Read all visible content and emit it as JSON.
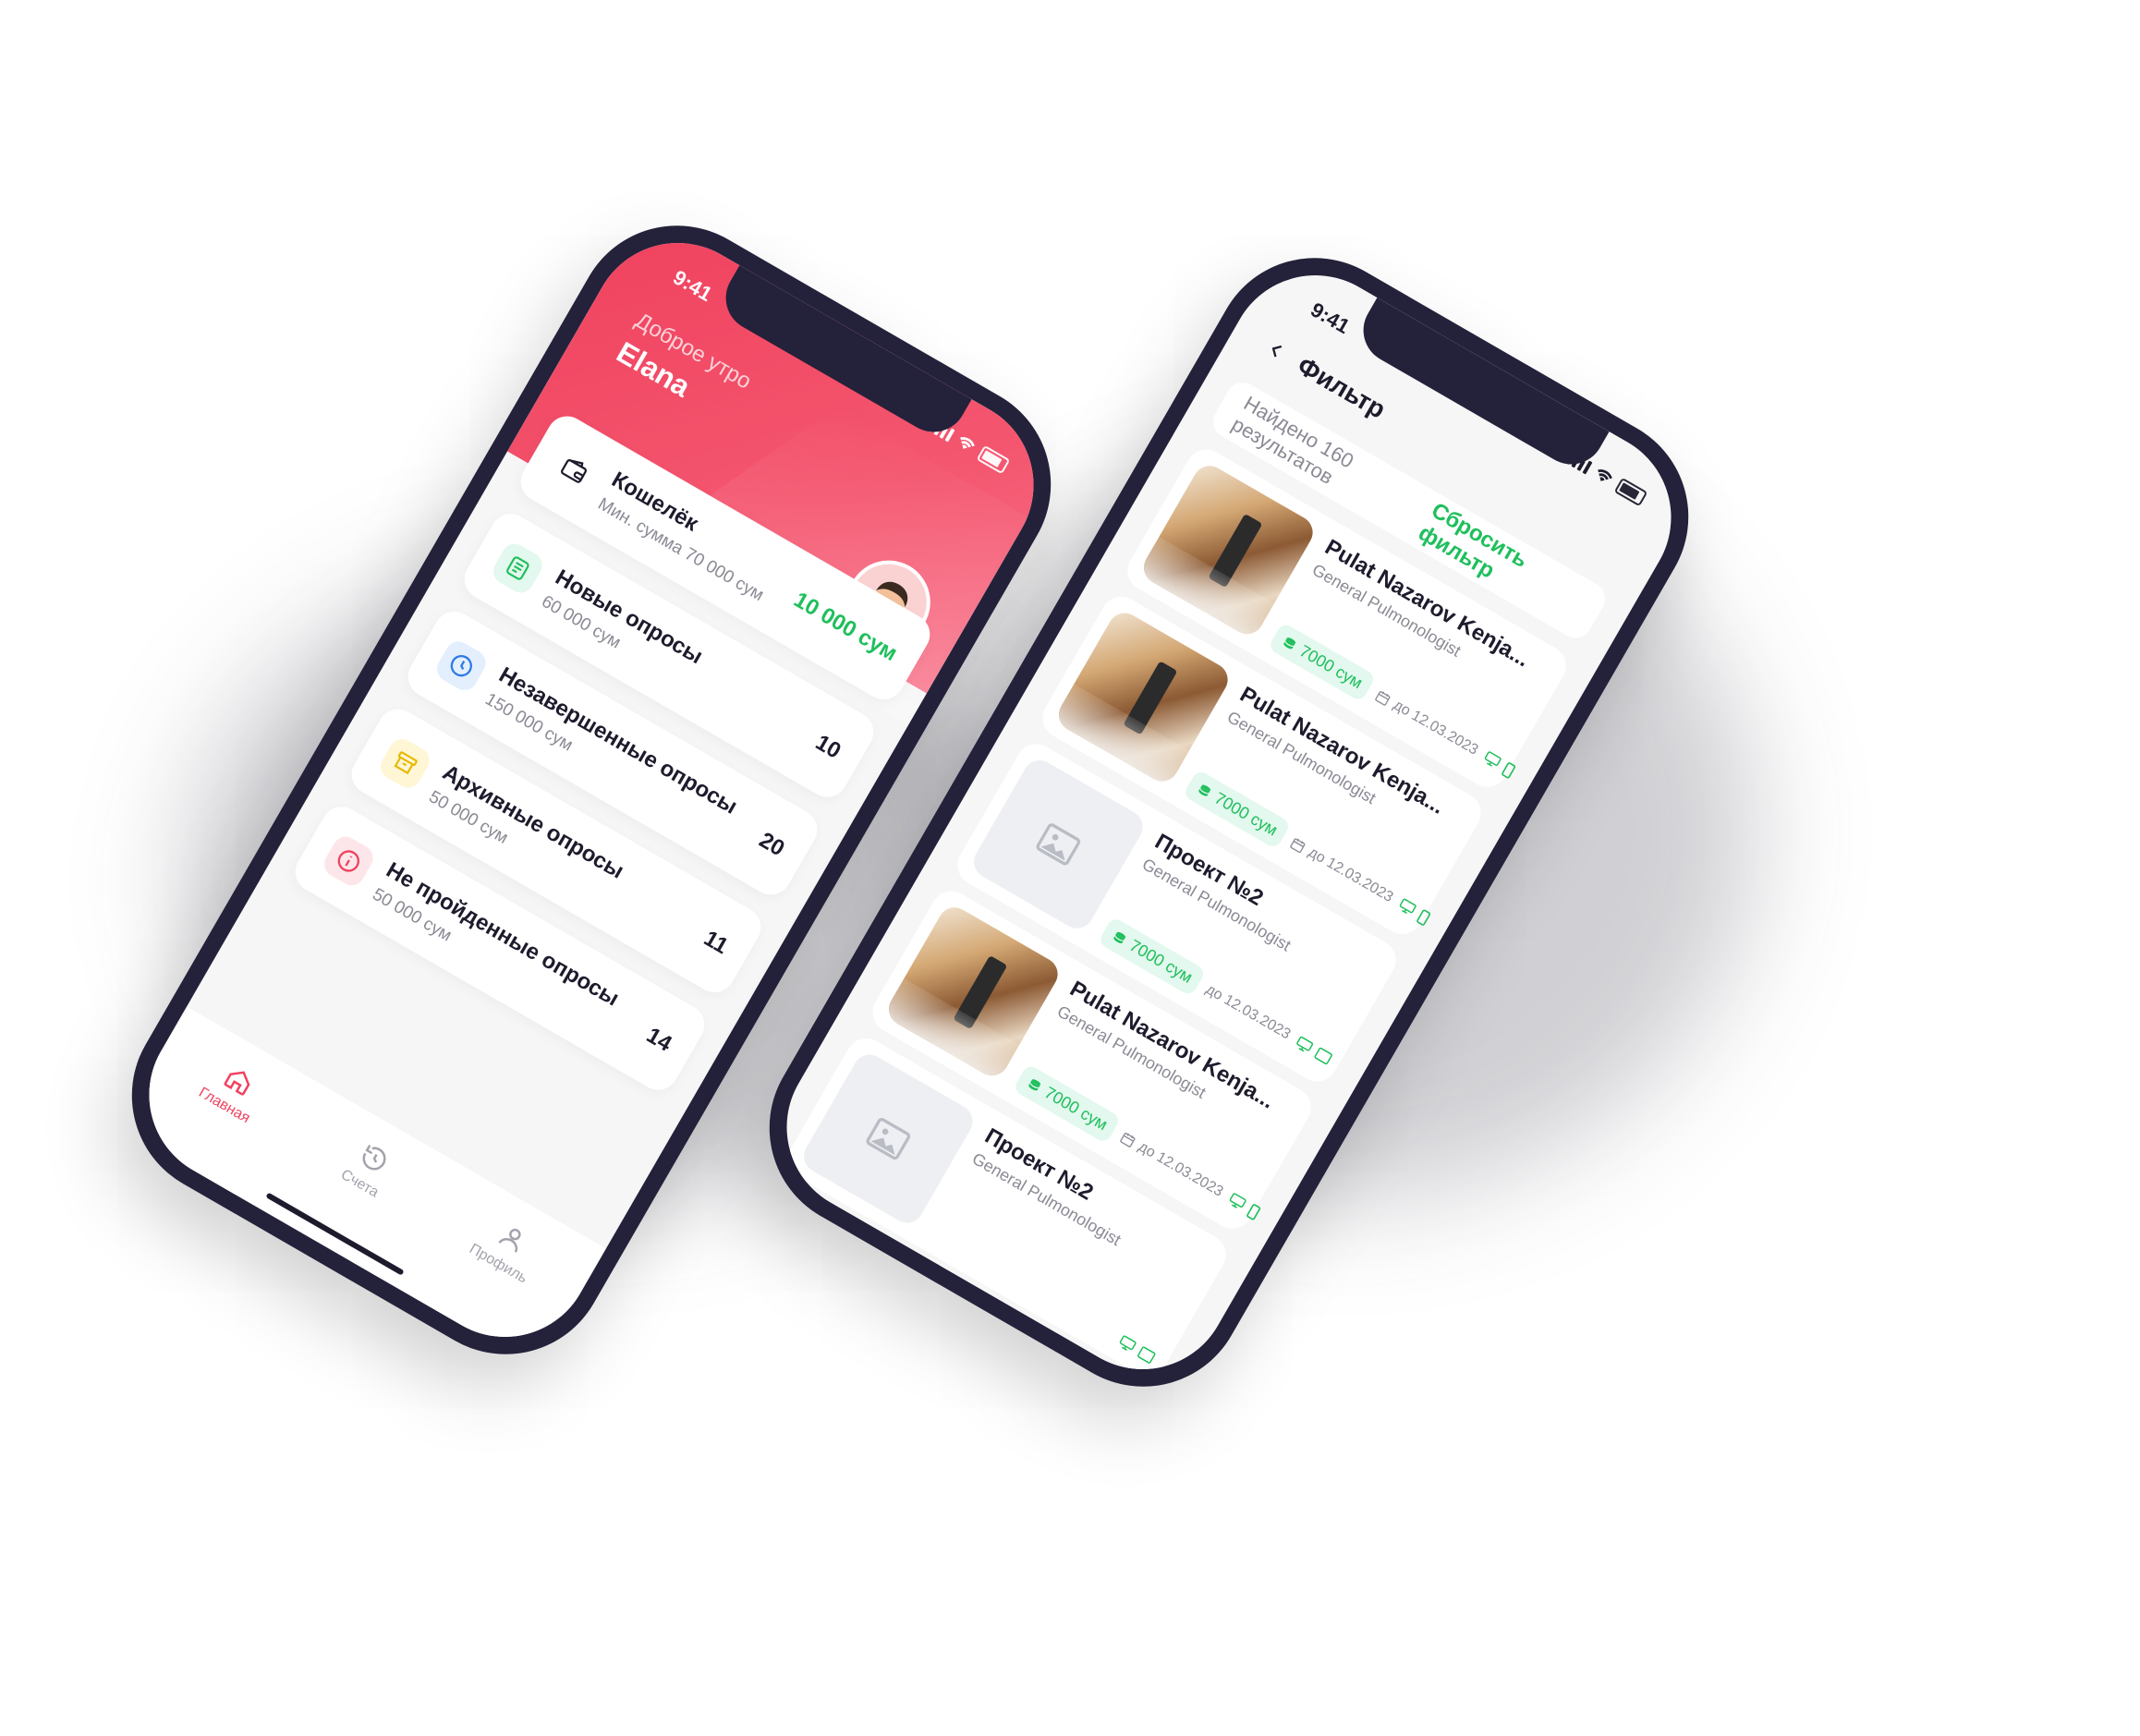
{
  "colors": {
    "accent_red": "#f0425f",
    "accent_green": "#1fbf5c",
    "frame": "#24213a"
  },
  "phone1": {
    "status_time": "9:41",
    "greeting": "Доброе утро",
    "user_name": "Elana",
    "wallet": {
      "icon": "wallet-icon",
      "title": "Кошелёк",
      "subtitle": "Мин. сумма 70 000 сум",
      "value": "10 000 сум"
    },
    "cards": [
      {
        "icon": "document-icon",
        "title": "Новые опросы",
        "subtitle": "60 000 сум",
        "count": "10"
      },
      {
        "icon": "clock-icon",
        "title": "Незавершенные опросы",
        "subtitle": "150 000 сум",
        "count": "20"
      },
      {
        "icon": "archive-icon",
        "title": "Архивные опросы",
        "subtitle": "50 000 сум",
        "count": "11"
      },
      {
        "icon": "info-icon",
        "title": "Не пройденные опросы",
        "subtitle": "50 000 сум",
        "count": "14"
      }
    ],
    "tabs": [
      {
        "icon": "home-icon",
        "label": "Главная"
      },
      {
        "icon": "history-icon",
        "label": "Счета"
      },
      {
        "icon": "user-icon",
        "label": "Профиль"
      }
    ]
  },
  "phone2": {
    "status_time": "9:41",
    "title": "Фильтр",
    "found_text": "Найдено 160 результатов",
    "reset_label": "Сбросить фильтр",
    "items": [
      {
        "thumb": "photo",
        "name": "Pulat Nazarov Kenja...",
        "role": "General Pulmonologist",
        "price": "7000 сум",
        "date": "до 12.03.2023"
      },
      {
        "thumb": "photo",
        "name": "Pulat Nazarov Kenja...",
        "role": "General Pulmonologist",
        "price": "7000 сум",
        "date": "до 12.03.2023"
      },
      {
        "thumb": "empty",
        "name": "Проект №2",
        "role": "General Pulmonologist",
        "price": "7000 сум",
        "date": "до 12.03.2023"
      },
      {
        "thumb": "photo",
        "name": "Pulat Nazarov Kenja...",
        "role": "General Pulmonologist",
        "price": "7000 сум",
        "date": "до 12.03.2023"
      },
      {
        "thumb": "empty",
        "name": "Проект №2",
        "role": "General Pulmonologist",
        "price": "",
        "date": ""
      }
    ]
  }
}
